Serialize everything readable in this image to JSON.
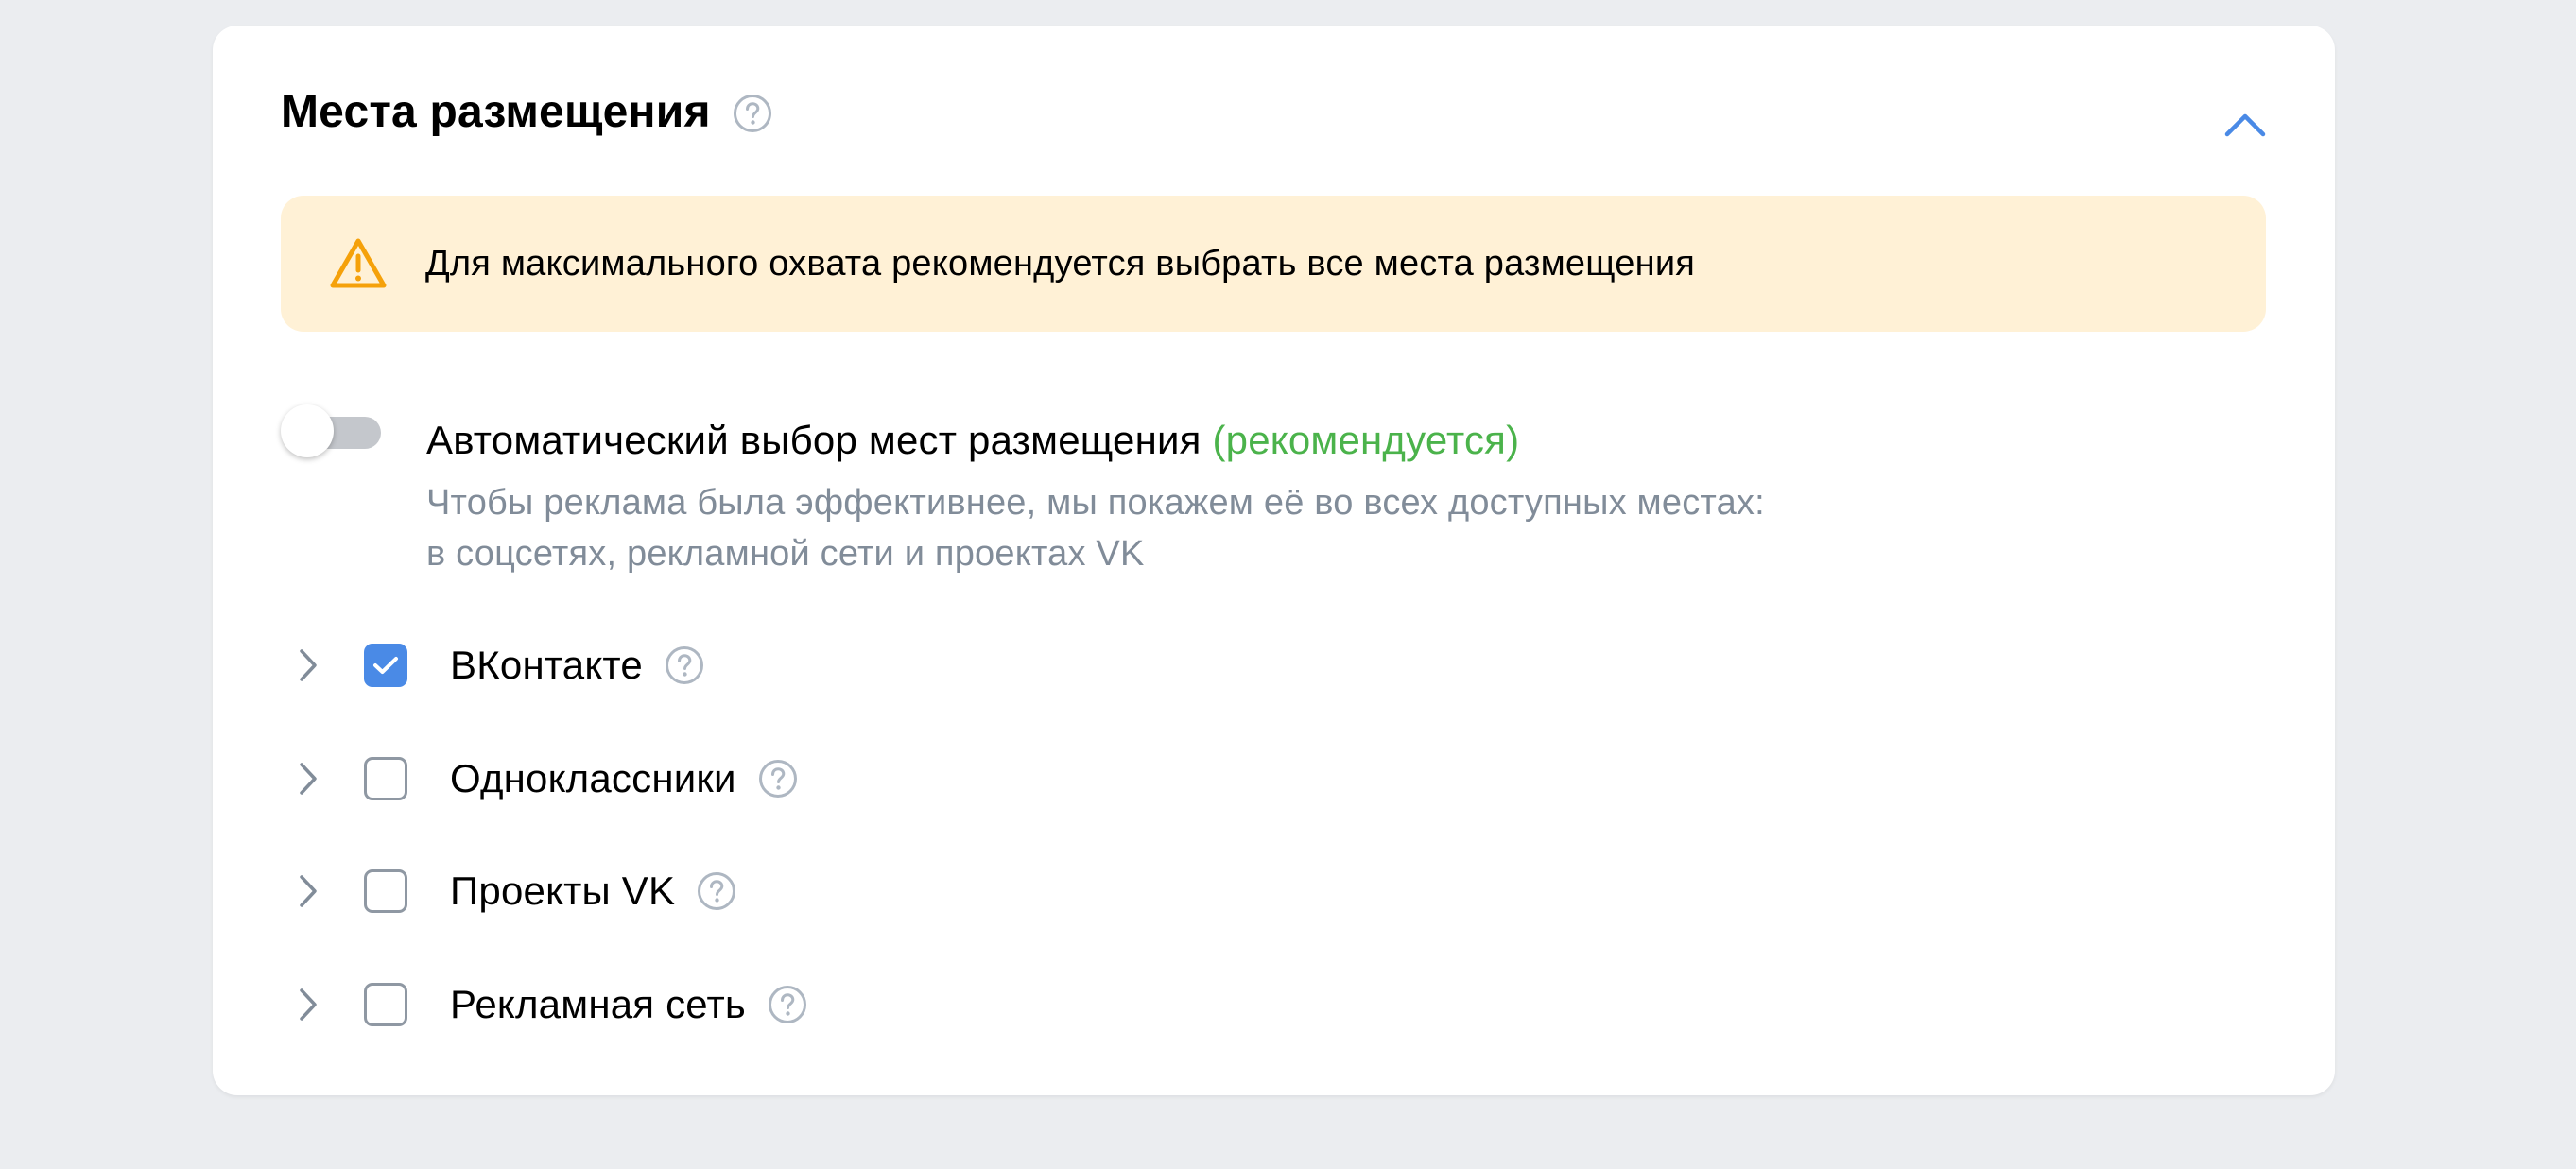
{
  "section": {
    "title": "Места размещения",
    "collapse_icon": "chevron-up-icon",
    "help_icon": "question-circle-icon"
  },
  "warning": {
    "icon": "warning-triangle-icon",
    "text": "Для максимального охвата рекомендуется выбрать все места размещения",
    "background": "#fff1d6",
    "icon_color": "#f5a10a"
  },
  "auto_placement": {
    "enabled": false,
    "label": "Автоматический выбор мест размещения",
    "recommended": "(рекомендуется)",
    "description_line1": "Чтобы реклама была эффективнее, мы покажем её во всех доступных местах:",
    "description_line2": "в соцсетях, рекламной сети и проектах VK"
  },
  "placements": [
    {
      "label": "ВКонтакте",
      "checked": true
    },
    {
      "label": "Одноклассники",
      "checked": false
    },
    {
      "label": "Проекты VK",
      "checked": false
    },
    {
      "label": "Рекламная сеть",
      "checked": false
    }
  ],
  "colors": {
    "accent": "#4a8ae6",
    "recommended_green": "#4bb34b",
    "secondary_text": "#818c99",
    "page_background": "#ebedf0"
  }
}
